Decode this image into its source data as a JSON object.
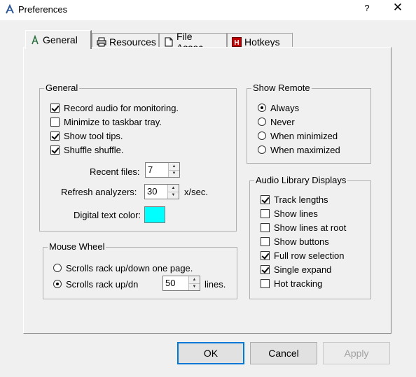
{
  "window": {
    "title": "Preferences",
    "help_glyph": "?",
    "close_glyph": "✕"
  },
  "tabs": [
    {
      "label": "General",
      "icon": "tuning-fork-icon",
      "selected": true
    },
    {
      "label": "Resources",
      "icon": "printer-icon",
      "selected": false
    },
    {
      "label": "File Assoc.",
      "icon": "document-icon",
      "selected": false
    },
    {
      "label": "Hotkeys",
      "icon": "hotkey-h-icon",
      "selected": false
    }
  ],
  "general": {
    "legend": "General",
    "checkboxes": [
      {
        "label": "Record audio for monitoring.",
        "checked": true
      },
      {
        "label": "Minimize to taskbar tray.",
        "checked": false
      },
      {
        "label": "Show tool tips.",
        "checked": true
      },
      {
        "label": "Shuffle shuffle.",
        "checked": true
      }
    ],
    "recent_files_label": "Recent files:",
    "recent_files_value": "7",
    "refresh_label": "Refresh analyzers:",
    "refresh_value": "30",
    "refresh_unit": "x/sec.",
    "digital_color_label": "Digital text color:",
    "digital_color": "#00ffff"
  },
  "mouse_wheel": {
    "legend": "Mouse Wheel",
    "options": [
      {
        "label": "Scrolls rack up/down one page.",
        "checked": false
      },
      {
        "label": "Scrolls rack up/dn",
        "checked": true
      }
    ],
    "lines_value": "50",
    "lines_unit": "lines."
  },
  "show_remote": {
    "legend": "Show Remote",
    "options": [
      {
        "label": "Always",
        "checked": true
      },
      {
        "label": "Never",
        "checked": false
      },
      {
        "label": "When minimized",
        "checked": false
      },
      {
        "label": "When maximized",
        "checked": false
      }
    ]
  },
  "audio_library": {
    "legend": "Audio Library Displays",
    "checkboxes": [
      {
        "label": "Track lengths",
        "checked": true
      },
      {
        "label": "Show lines",
        "checked": false
      },
      {
        "label": "Show lines at root",
        "checked": false
      },
      {
        "label": "Show buttons",
        "checked": false
      },
      {
        "label": "Full row selection",
        "checked": true
      },
      {
        "label": "Single expand",
        "checked": true
      },
      {
        "label": "Hot tracking",
        "checked": false
      }
    ]
  },
  "buttons": {
    "ok": "OK",
    "cancel": "Cancel",
    "apply": "Apply"
  }
}
